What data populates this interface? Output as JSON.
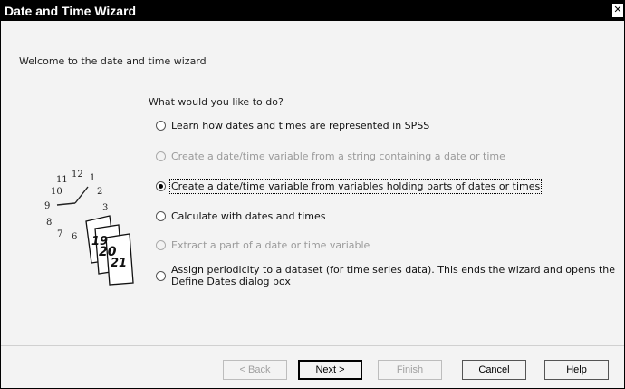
{
  "window": {
    "title": "Date and Time Wizard",
    "close_glyph": "✕"
  },
  "welcome_text": "Welcome to the date and time wizard",
  "question": "What would you like to do?",
  "options": [
    {
      "label": "Learn how dates and times are represented in SPSS",
      "enabled": true,
      "selected": false
    },
    {
      "label": "Create a date/time variable from a string containing a date or time",
      "enabled": false,
      "selected": false
    },
    {
      "label": "Create a date/time variable from  variables holding parts of dates or times",
      "enabled": true,
      "selected": true
    },
    {
      "label": "Calculate with dates and times",
      "enabled": true,
      "selected": false
    },
    {
      "label": "Extract a part of a date or time variable",
      "enabled": false,
      "selected": false
    },
    {
      "label": "Assign periodicity to a dataset (for time series data). This ends the wizard and opens the Define Dates dialog box",
      "enabled": true,
      "selected": false
    }
  ],
  "clock": {
    "numbers": [
      "11",
      "12",
      "1",
      "10",
      "2",
      "9",
      "3",
      "8",
      "7",
      "6"
    ],
    "calendar_pages": [
      "19",
      "20",
      "21"
    ]
  },
  "buttons": {
    "back": "< Back",
    "next": "Next >",
    "finish": "Finish",
    "cancel": "Cancel",
    "help": "Help"
  }
}
